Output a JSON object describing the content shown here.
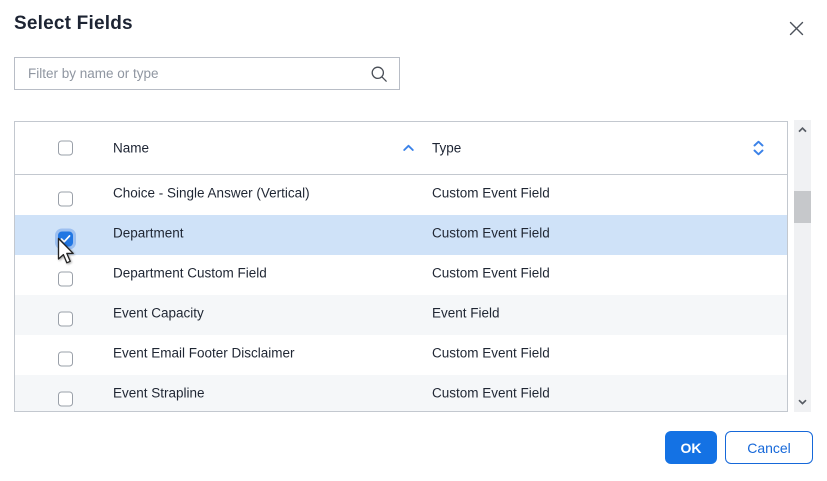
{
  "dialog": {
    "title": "Select Fields"
  },
  "filter": {
    "placeholder": "Filter by name or type",
    "value": ""
  },
  "table": {
    "select_all_checked": false,
    "columns": [
      {
        "id": "name",
        "label": "Name",
        "sort": "ascending"
      },
      {
        "id": "type",
        "label": "Type",
        "sort": "unsorted"
      }
    ],
    "rows": [
      {
        "name": "Choice - Single Answer (Vertical)",
        "type": "Custom Event Field",
        "checked": false,
        "selected": false
      },
      {
        "name": "Department",
        "type": "Custom Event Field",
        "checked": true,
        "selected": true
      },
      {
        "name": "Department Custom Field",
        "type": "Custom Event Field",
        "checked": false,
        "selected": false
      },
      {
        "name": "Event Capacity",
        "type": "Event Field",
        "checked": false,
        "selected": false
      },
      {
        "name": "Event Email Footer Disclaimer",
        "type": "Custom Event Field",
        "checked": false,
        "selected": false
      },
      {
        "name": "Event Strapline",
        "type": "Custom Event Field",
        "checked": false,
        "selected": false
      }
    ]
  },
  "scrollbar": {
    "orientation": "vertical",
    "thumb_position": "upper-quarter"
  },
  "footer": {
    "ok": "OK",
    "cancel": "Cancel"
  },
  "icons": {
    "close": "x-cross",
    "search": "magnifying-glass",
    "sort_ascending": "chevron-up",
    "sort_toggle": "chevron-up-down",
    "scroll_up": "chevron-up",
    "scroll_down": "chevron-down",
    "checkmark": "check",
    "pointer": "mouse-arrow"
  },
  "colors": {
    "accent_blue": "#1472e4",
    "cancel_blue": "#1668d9",
    "selected_row": "#cfe2f8",
    "stripe_row": "#f5f7f9",
    "sort_icon_blue": "#3b82e8",
    "text_dark": "#1d2433",
    "border_gray": "#c3c8cf"
  }
}
